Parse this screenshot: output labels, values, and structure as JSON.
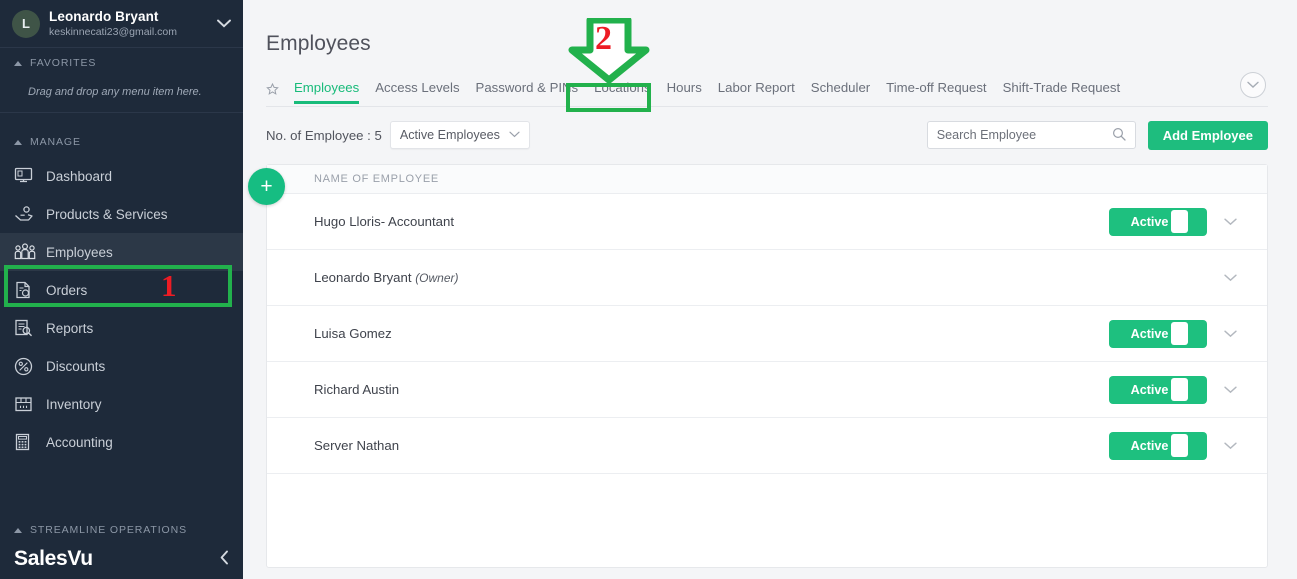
{
  "sidebar": {
    "user": {
      "initial": "L",
      "name": "Leonardo Bryant",
      "email": "keskinnecati23@gmail.com",
      "caret": "chevron-down-icon"
    },
    "favorites": {
      "label": "FAVORITES",
      "hint": "Drag and drop any menu item here."
    },
    "manage": {
      "label": "MANAGE"
    },
    "items": [
      {
        "label": "Dashboard",
        "icon": "monitor-icon"
      },
      {
        "label": "Products & Services",
        "icon": "hand-gear-icon"
      },
      {
        "label": "Employees",
        "icon": "people-icon"
      },
      {
        "label": "Orders",
        "icon": "document-check-icon"
      },
      {
        "label": "Reports",
        "icon": "report-search-icon"
      },
      {
        "label": "Discounts",
        "icon": "percent-circle-icon"
      },
      {
        "label": "Inventory",
        "icon": "box-icon"
      },
      {
        "label": "Accounting",
        "icon": "calculator-icon"
      }
    ],
    "streamline": {
      "label": "STREAMLINE OPERATIONS"
    },
    "brand": {
      "name": "SalesVu",
      "collapse": "chevron-left-icon"
    }
  },
  "header": {
    "title": "Employees"
  },
  "tabs": {
    "star": "star-icon",
    "expand": "chevron-down-circle-icon",
    "items": [
      {
        "label": "Employees",
        "active": true
      },
      {
        "label": "Access Levels",
        "active": false
      },
      {
        "label": "Password & PINs",
        "active": false
      },
      {
        "label": "Locations",
        "active": false
      },
      {
        "label": "Hours",
        "active": false
      },
      {
        "label": "Labor Report",
        "active": false
      },
      {
        "label": "Scheduler",
        "active": false
      },
      {
        "label": "Time-off Request",
        "active": false
      },
      {
        "label": "Shift-Trade Request",
        "active": false
      }
    ]
  },
  "toolbar": {
    "count_label": "No. of Employee : 5",
    "filter_value": "Active Employees",
    "filter_chevron": "chevron-down-icon",
    "search_placeholder": "Search Employee",
    "search_value": "",
    "search_icon": "search-icon",
    "add_label": "Add Employee"
  },
  "table": {
    "add_fab": "plus-icon",
    "column_header": "NAME OF EMPLOYEE",
    "rows": [
      {
        "name": "Hugo Lloris- Accountant",
        "suffix": "",
        "toggle": "Active",
        "has_toggle": true,
        "chevron": "chevron-down-icon"
      },
      {
        "name": "Leonardo Bryant ",
        "suffix": "(Owner)",
        "toggle": "",
        "has_toggle": false,
        "chevron": "chevron-down-icon"
      },
      {
        "name": "Luisa Gomez",
        "suffix": "",
        "toggle": "Active",
        "has_toggle": true,
        "chevron": "chevron-down-icon"
      },
      {
        "name": "Richard Austin",
        "suffix": "",
        "toggle": "Active",
        "has_toggle": true,
        "chevron": "chevron-down-icon"
      },
      {
        "name": "Server Nathan",
        "suffix": "",
        "toggle": "Active",
        "has_toggle": true,
        "chevron": "chevron-down-icon"
      }
    ]
  },
  "annotations": [
    {
      "number": "1",
      "target": "sidebar-item-employees"
    },
    {
      "number": "2",
      "target": "tab-locations"
    }
  ],
  "colors": {
    "accent_green": "#1ebd7e",
    "annotation_green": "#22b14c",
    "annotation_red": "#ed1c24",
    "sidebar_bg": "#1e2a3a",
    "page_bg": "#f4f5f7"
  }
}
